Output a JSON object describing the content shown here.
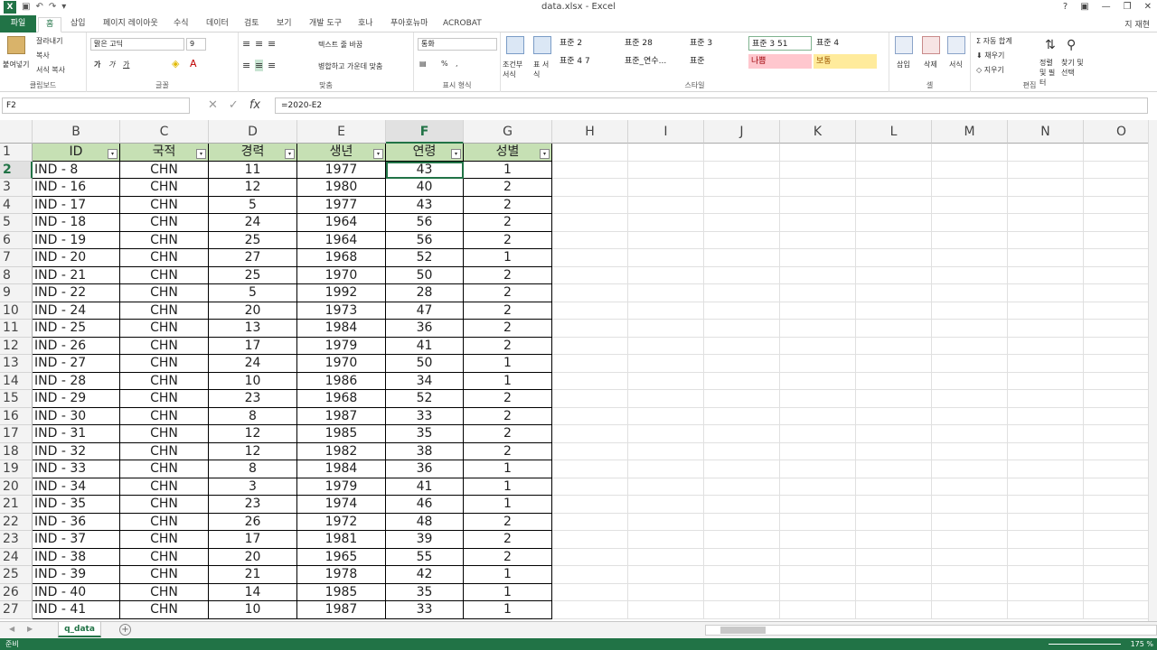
{
  "window": {
    "title": "data.xlsx - Excel",
    "user": "지 재현"
  },
  "tabs": [
    "파일",
    "홈",
    "삽입",
    "페이지 레이아웃",
    "수식",
    "데이터",
    "검토",
    "보기",
    "개발 도구",
    "호나",
    "푸아호뉴마",
    "ACROBAT"
  ],
  "ribbon": {
    "clipboard": {
      "paste": "붙여넣기",
      "cut": "잘라내기",
      "copy": "복사",
      "format_painter": "서식 복사",
      "label": "클립보드"
    },
    "font": {
      "name": "맑은 고딕",
      "size": "9",
      "bold": "가",
      "italic": "가",
      "underline": "가",
      "label": "글꼴"
    },
    "align": {
      "wrap": "텍스트 줄 바꿈",
      "merge": "병합하고 가운데 맞춤",
      "label": "맞춤"
    },
    "number": {
      "format": "통화",
      "label": "표시 형식"
    },
    "styles": {
      "cond": "조건부 서식",
      "table": "표 서식",
      "items": [
        "표준 2",
        "표준 28",
        "표준 3",
        "표준 3 51",
        "표준 4",
        "표준 4 7",
        "표준_연수...",
        "표준",
        "나쁨",
        "보통"
      ],
      "label": "스타일"
    },
    "cells": {
      "insert": "삽입",
      "delete": "삭제",
      "format": "서식",
      "label": "셀"
    },
    "edit": {
      "autosum": "자동 합계",
      "fill": "채우기",
      "clear": "지우기",
      "sort": "정렬 및 필터",
      "find": "찾기 및 선택",
      "label": "편집"
    }
  },
  "formula": {
    "namebox": "F2",
    "content": "=2020-E2"
  },
  "columns": [
    "B",
    "C",
    "D",
    "E",
    "F",
    "G",
    "H",
    "I",
    "J",
    "K",
    "L",
    "M",
    "N",
    "O"
  ],
  "header_row": [
    "ID",
    "국적",
    "경력",
    "생년",
    "연령",
    "성별"
  ],
  "rows": [
    [
      "IND - 8",
      "CHN",
      "11",
      "1977",
      "43",
      "1"
    ],
    [
      "IND - 16",
      "CHN",
      "12",
      "1980",
      "40",
      "2"
    ],
    [
      "IND - 17",
      "CHN",
      "5",
      "1977",
      "43",
      "2"
    ],
    [
      "IND - 18",
      "CHN",
      "24",
      "1964",
      "56",
      "2"
    ],
    [
      "IND - 19",
      "CHN",
      "25",
      "1964",
      "56",
      "2"
    ],
    [
      "IND - 20",
      "CHN",
      "27",
      "1968",
      "52",
      "1"
    ],
    [
      "IND - 21",
      "CHN",
      "25",
      "1970",
      "50",
      "2"
    ],
    [
      "IND - 22",
      "CHN",
      "5",
      "1992",
      "28",
      "2"
    ],
    [
      "IND - 24",
      "CHN",
      "20",
      "1973",
      "47",
      "2"
    ],
    [
      "IND - 25",
      "CHN",
      "13",
      "1984",
      "36",
      "2"
    ],
    [
      "IND - 26",
      "CHN",
      "17",
      "1979",
      "41",
      "2"
    ],
    [
      "IND - 27",
      "CHN",
      "24",
      "1970",
      "50",
      "1"
    ],
    [
      "IND - 28",
      "CHN",
      "10",
      "1986",
      "34",
      "1"
    ],
    [
      "IND - 29",
      "CHN",
      "23",
      "1968",
      "52",
      "2"
    ],
    [
      "IND - 30",
      "CHN",
      "8",
      "1987",
      "33",
      "2"
    ],
    [
      "IND - 31",
      "CHN",
      "12",
      "1985",
      "35",
      "2"
    ],
    [
      "IND - 32",
      "CHN",
      "12",
      "1982",
      "38",
      "2"
    ],
    [
      "IND - 33",
      "CHN",
      "8",
      "1984",
      "36",
      "1"
    ],
    [
      "IND - 34",
      "CHN",
      "3",
      "1979",
      "41",
      "1"
    ],
    [
      "IND - 35",
      "CHN",
      "23",
      "1974",
      "46",
      "1"
    ],
    [
      "IND - 36",
      "CHN",
      "26",
      "1972",
      "48",
      "2"
    ],
    [
      "IND - 37",
      "CHN",
      "17",
      "1981",
      "39",
      "2"
    ],
    [
      "IND - 38",
      "CHN",
      "20",
      "1965",
      "55",
      "2"
    ],
    [
      "IND - 39",
      "CHN",
      "21",
      "1978",
      "42",
      "1"
    ],
    [
      "IND - 40",
      "CHN",
      "14",
      "1985",
      "35",
      "1"
    ],
    [
      "IND - 41",
      "CHN",
      "10",
      "1987",
      "33",
      "1"
    ]
  ],
  "sheet": {
    "name": "q_data"
  },
  "status": {
    "ready": "준비",
    "zoom": "175 %"
  }
}
